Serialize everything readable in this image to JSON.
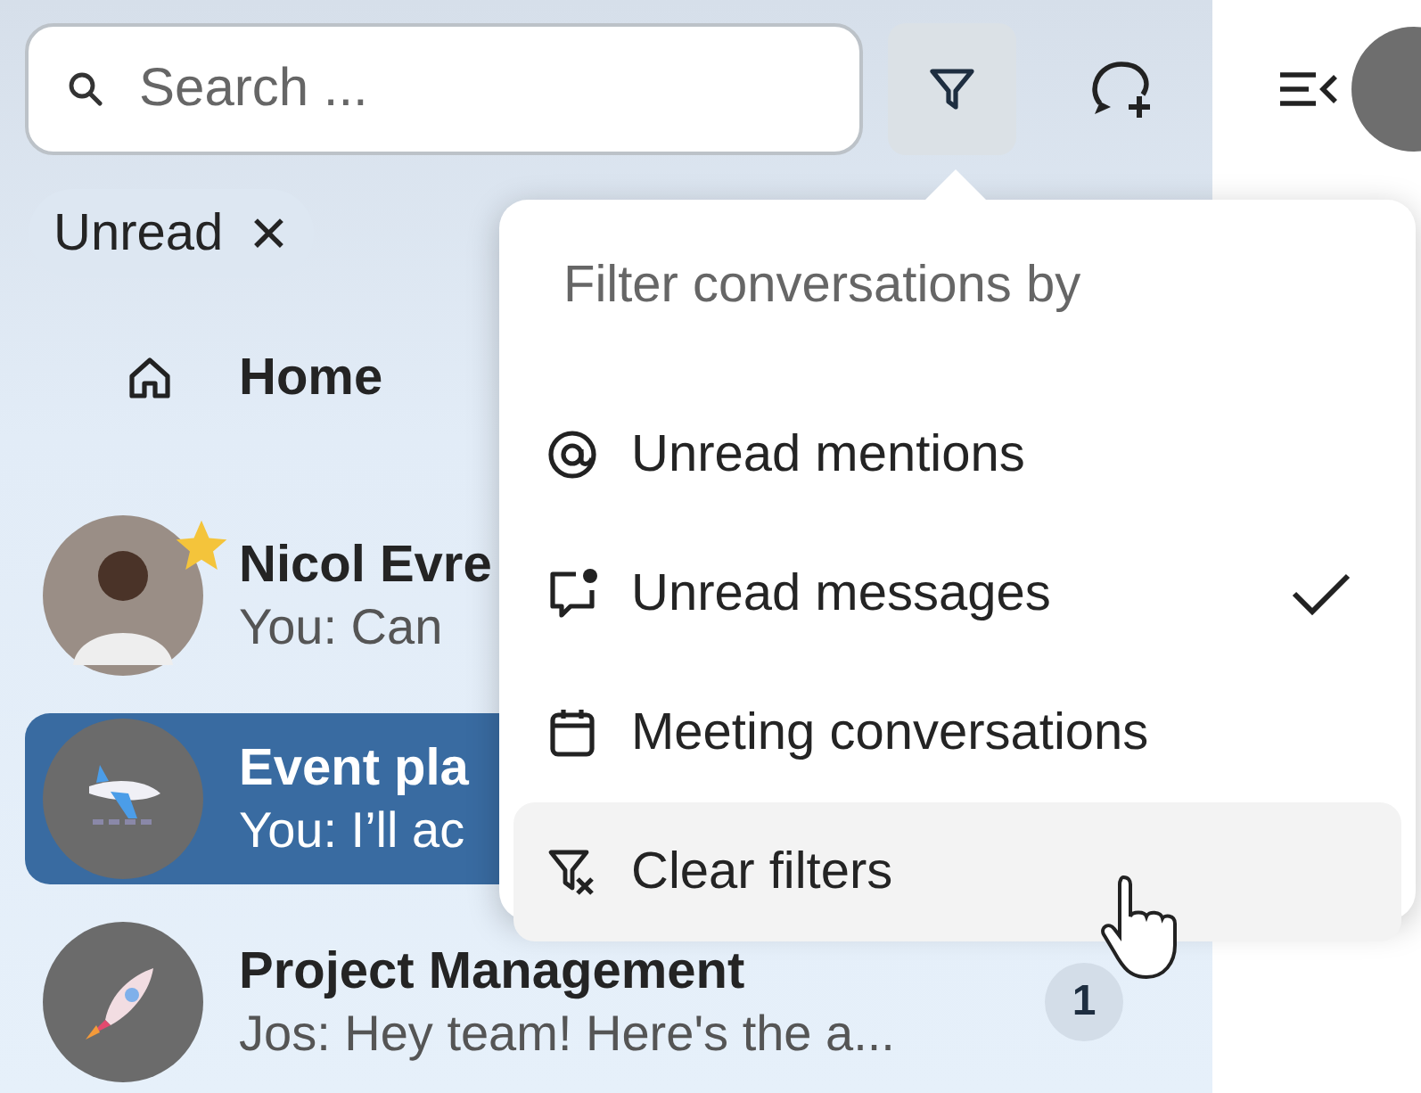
{
  "search": {
    "placeholder": "Search ..."
  },
  "filter_chips": [
    {
      "label": "Unread",
      "remove": "✕"
    }
  ],
  "nav": [
    {
      "label": "Home",
      "kind": "home"
    }
  ],
  "conversations": [
    {
      "name": "Nicol Evre",
      "preview": "You: Can",
      "kind": "person",
      "starred": true,
      "selected": false
    },
    {
      "name": "Event pla",
      "preview": "You: I’ll ac",
      "kind": "plane",
      "starred": false,
      "selected": true
    },
    {
      "name": "Project Management",
      "preview": "Jos: Hey team! Here's the a...",
      "kind": "rocket",
      "starred": false,
      "selected": false,
      "unread": "1"
    }
  ],
  "filter_menu": {
    "title": "Filter conversations by",
    "items": [
      {
        "kind": "mentions",
        "label": "Unread mentions",
        "checked": false,
        "highlighted": false
      },
      {
        "kind": "messages",
        "label": "Unread messages",
        "checked": true,
        "highlighted": false
      },
      {
        "kind": "meetings",
        "label": "Meeting conversations",
        "checked": false,
        "highlighted": false
      },
      {
        "kind": "clear",
        "label": "Clear filters",
        "checked": false,
        "highlighted": true
      }
    ]
  }
}
